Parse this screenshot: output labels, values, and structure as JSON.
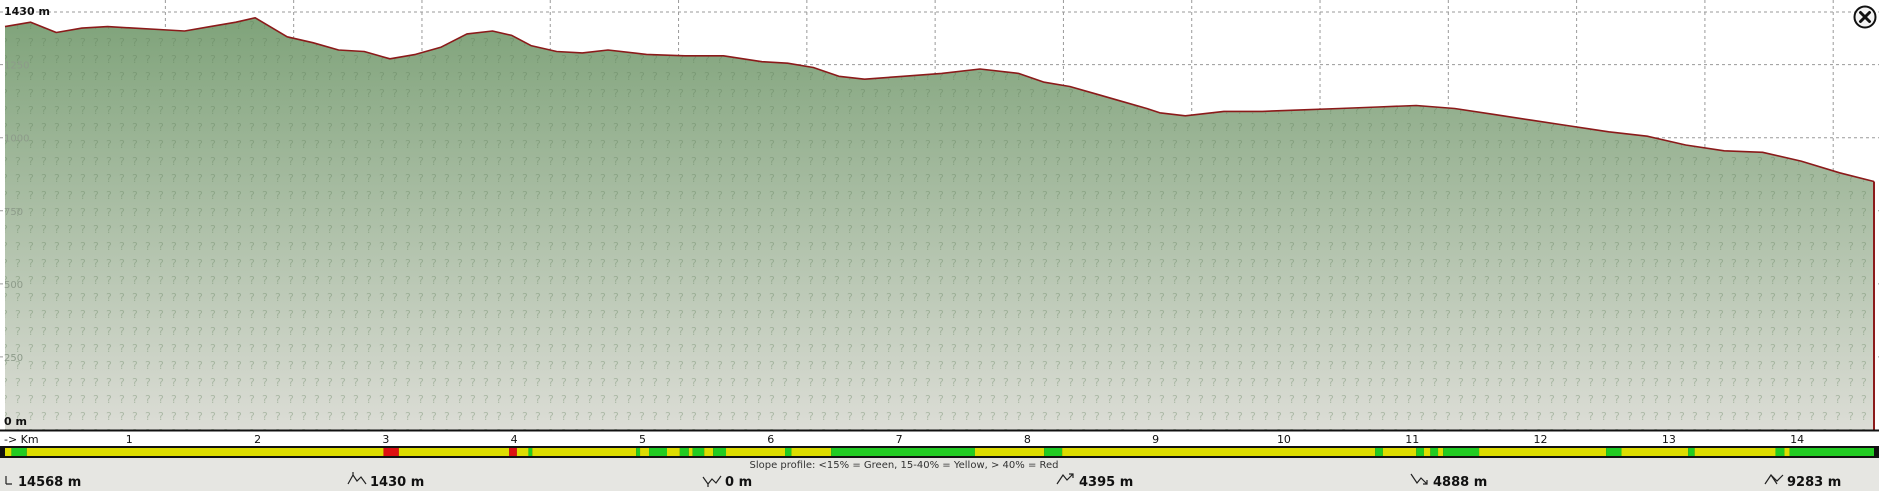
{
  "chart_data": {
    "type": "area",
    "title": "",
    "xlabel": "",
    "ylabel": "",
    "xlim": [
      0,
      14.568
    ],
    "ylim": [
      0,
      1430
    ],
    "grid": true,
    "y_ticks": [
      {
        "value": 1430,
        "label": "1430 m",
        "style": "bold"
      },
      {
        "value": 1250,
        "label": "1250",
        "style": "faint"
      },
      {
        "value": 1000,
        "label": "1000",
        "style": "faint"
      },
      {
        "value": 750,
        "label": "750",
        "style": "faint"
      },
      {
        "value": 500,
        "label": "500",
        "style": "faint"
      },
      {
        "value": 250,
        "label": "250",
        "style": "faint"
      },
      {
        "value": 0,
        "label": "0 m",
        "style": "bold"
      }
    ],
    "x_unit_label": "-> Km",
    "x_ticks": [
      {
        "value": 1,
        "label": "1"
      },
      {
        "value": 2,
        "label": "2"
      },
      {
        "value": 3,
        "label": "3"
      },
      {
        "value": 4,
        "label": "4"
      },
      {
        "value": 5,
        "label": "5"
      },
      {
        "value": 6,
        "label": "6"
      },
      {
        "value": 7,
        "label": "7"
      },
      {
        "value": 8,
        "label": "8"
      },
      {
        "value": 9,
        "label": "9"
      },
      {
        "value": 10,
        "label": "10"
      },
      {
        "value": 11,
        "label": "11"
      },
      {
        "value": 12,
        "label": "12"
      },
      {
        "value": 13,
        "label": "13"
      },
      {
        "value": 14,
        "label": "14"
      }
    ],
    "series": [
      {
        "x": [
          0,
          0.2,
          0.4,
          0.6,
          0.8,
          1.0,
          1.2,
          1.4,
          1.6,
          1.8,
          1.95,
          2.2,
          2.4,
          2.6,
          2.8,
          3.0,
          3.2,
          3.4,
          3.6,
          3.8,
          3.95,
          4.1,
          4.3,
          4.5,
          4.7,
          5.0,
          5.3,
          5.6,
          5.9,
          6.1,
          6.3,
          6.5,
          6.7,
          7.0,
          7.3,
          7.6,
          7.9,
          8.1,
          8.3,
          8.5,
          8.7,
          8.9,
          9.0,
          9.2,
          9.5,
          9.8,
          10.1,
          10.4,
          10.7,
          11.0,
          11.3,
          11.6,
          11.9,
          12.2,
          12.5,
          12.8,
          13.1,
          13.4,
          13.7,
          14.0,
          14.3,
          14.568
        ],
        "y": [
          1380,
          1395,
          1360,
          1375,
          1380,
          1375,
          1370,
          1365,
          1380,
          1395,
          1410,
          1345,
          1325,
          1300,
          1295,
          1270,
          1285,
          1310,
          1355,
          1365,
          1350,
          1315,
          1295,
          1290,
          1300,
          1285,
          1280,
          1280,
          1260,
          1255,
          1240,
          1210,
          1200,
          1210,
          1220,
          1235,
          1220,
          1190,
          1175,
          1150,
          1125,
          1100,
          1085,
          1075,
          1090,
          1090,
          1095,
          1100,
          1105,
          1110,
          1100,
          1080,
          1060,
          1040,
          1020,
          1005,
          975,
          955,
          950,
          920,
          880,
          850
        ]
      }
    ],
    "slope_profile": {
      "label": "Slope profile: <15% = Green, 15-40% = Yellow, > 40% = Red",
      "colors": {
        "green": "#22cc22",
        "yellow": "#dddd00",
        "red": "#dd1111"
      },
      "segments": [
        {
          "from": 0.0,
          "to": 0.05,
          "color": "yellow"
        },
        {
          "from": 0.05,
          "to": 0.17,
          "color": "green"
        },
        {
          "from": 0.17,
          "to": 2.95,
          "color": "yellow"
        },
        {
          "from": 2.95,
          "to": 3.07,
          "color": "red"
        },
        {
          "from": 3.07,
          "to": 3.93,
          "color": "yellow"
        },
        {
          "from": 3.93,
          "to": 3.99,
          "color": "red"
        },
        {
          "from": 3.99,
          "to": 4.08,
          "color": "yellow"
        },
        {
          "from": 4.08,
          "to": 4.11,
          "color": "green"
        },
        {
          "from": 4.11,
          "to": 4.92,
          "color": "yellow"
        },
        {
          "from": 4.92,
          "to": 4.95,
          "color": "green"
        },
        {
          "from": 4.95,
          "to": 5.02,
          "color": "yellow"
        },
        {
          "from": 5.02,
          "to": 5.16,
          "color": "green"
        },
        {
          "from": 5.16,
          "to": 5.26,
          "color": "yellow"
        },
        {
          "from": 5.26,
          "to": 5.33,
          "color": "green"
        },
        {
          "from": 5.33,
          "to": 5.36,
          "color": "yellow"
        },
        {
          "from": 5.36,
          "to": 5.45,
          "color": "green"
        },
        {
          "from": 5.45,
          "to": 5.52,
          "color": "yellow"
        },
        {
          "from": 5.52,
          "to": 5.62,
          "color": "green"
        },
        {
          "from": 5.62,
          "to": 6.08,
          "color": "yellow"
        },
        {
          "from": 6.08,
          "to": 6.13,
          "color": "green"
        },
        {
          "from": 6.13,
          "to": 6.44,
          "color": "yellow"
        },
        {
          "from": 6.44,
          "to": 7.56,
          "color": "green"
        },
        {
          "from": 7.56,
          "to": 8.1,
          "color": "yellow"
        },
        {
          "from": 8.1,
          "to": 8.24,
          "color": "green"
        },
        {
          "from": 8.24,
          "to": 10.68,
          "color": "yellow"
        },
        {
          "from": 10.68,
          "to": 10.74,
          "color": "green"
        },
        {
          "from": 10.74,
          "to": 11.0,
          "color": "yellow"
        },
        {
          "from": 11.0,
          "to": 11.06,
          "color": "green"
        },
        {
          "from": 11.06,
          "to": 11.11,
          "color": "yellow"
        },
        {
          "from": 11.11,
          "to": 11.17,
          "color": "green"
        },
        {
          "from": 11.17,
          "to": 11.21,
          "color": "yellow"
        },
        {
          "from": 11.21,
          "to": 11.49,
          "color": "green"
        },
        {
          "from": 11.49,
          "to": 12.48,
          "color": "yellow"
        },
        {
          "from": 12.48,
          "to": 12.6,
          "color": "green"
        },
        {
          "from": 12.6,
          "to": 13.12,
          "color": "yellow"
        },
        {
          "from": 13.12,
          "to": 13.17,
          "color": "green"
        },
        {
          "from": 13.17,
          "to": 13.8,
          "color": "yellow"
        },
        {
          "from": 13.8,
          "to": 13.87,
          "color": "green"
        },
        {
          "from": 13.87,
          "to": 13.91,
          "color": "yellow"
        },
        {
          "from": 13.91,
          "to": 14.568,
          "color": "green"
        }
      ]
    }
  },
  "stats": [
    {
      "name": "distance",
      "icon": "distance-icon",
      "value": "14568 m"
    },
    {
      "name": "max-elevation",
      "icon": "max-elevation-icon",
      "value": "1430 m"
    },
    {
      "name": "min-elevation",
      "icon": "min-elevation-icon",
      "value": "0 m"
    },
    {
      "name": "total-ascent",
      "icon": "ascent-icon",
      "value": "4395 m"
    },
    {
      "name": "total-descent",
      "icon": "descent-icon",
      "value": "4888 m"
    },
    {
      "name": "elevation-change",
      "icon": "elevation-change-icon",
      "value": "9283 m"
    }
  ],
  "colors": {
    "background": "#e6e6e2",
    "fill_top": "#7fa37a",
    "fill_bottom": "#dcddd6",
    "profile_line": "#8b1a1a",
    "grid": "#9a9a9a",
    "axis": "#111111"
  },
  "close_icon": "close-icon"
}
